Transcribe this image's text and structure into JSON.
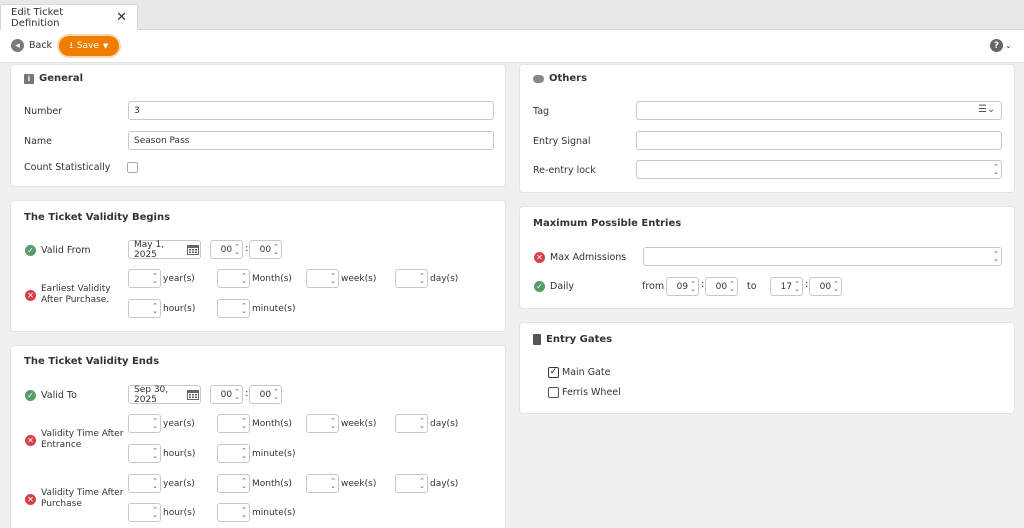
{
  "tab": {
    "title": "Edit Ticket Definition"
  },
  "toolbar": {
    "back_label": "Back",
    "save_label": "Save"
  },
  "general": {
    "title": "General",
    "number_label": "Number",
    "number_value": "3",
    "name_label": "Name",
    "name_value": "Season Pass",
    "count_label": "Count Statistically"
  },
  "validity_begins": {
    "title": "The Ticket Validity Begins",
    "valid_from_label": "Valid From",
    "valid_from_date": "May 1, 2025",
    "valid_from_hour": "00",
    "valid_from_minute": "00",
    "earliest_label_1": "Earliest Validity",
    "earliest_label_2": "After Purchase."
  },
  "validity_ends": {
    "title": "The Ticket Validity Ends",
    "valid_to_label": "Valid To",
    "valid_to_date": "Sep 30, 2025",
    "valid_to_hour": "00",
    "valid_to_minute": "00",
    "after_entrance_label_1": "Validity Time After",
    "after_entrance_label_2": "Entrance",
    "after_purchase_label_1": "Validity Time After",
    "after_purchase_label_2": "Purchase"
  },
  "units": {
    "year": "year(s)",
    "month": "Month(s)",
    "week": "week(s)",
    "day": "day(s)",
    "hour": "hour(s)",
    "minute": "minute(s)"
  },
  "others": {
    "title": "Others",
    "tag_label": "Tag",
    "entry_signal_label": "Entry Signal",
    "reentry_label": "Re-entry lock"
  },
  "max_entries": {
    "title": "Maximum Possible Entries",
    "max_admissions_label": "Max Admissions",
    "daily_label": "Daily",
    "from_label": "from",
    "to_label": "to",
    "from_hour": "09",
    "from_minute": "00",
    "to_hour": "17",
    "to_minute": "00"
  },
  "entry_gates": {
    "title": "Entry Gates",
    "gates": [
      {
        "label": "Main Gate",
        "checked": true
      },
      {
        "label": "Ferris Wheel",
        "checked": false
      }
    ]
  },
  "colors": {
    "accent": "#f07d00",
    "ok": "#5a9a6a",
    "error": "#d7404a"
  }
}
